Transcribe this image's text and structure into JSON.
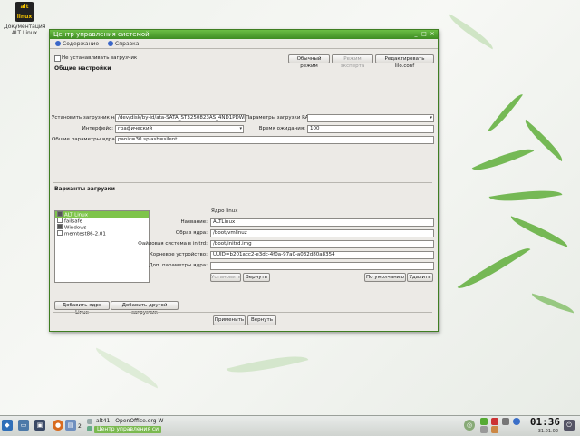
{
  "desktop": {
    "icon_label": "Документация ALT Linux",
    "logo_text": "alt linux"
  },
  "window": {
    "title": "Центр управления системой",
    "tabs": [
      {
        "label": "Содержание",
        "icon": "home-icon"
      },
      {
        "label": "Справка",
        "icon": "help-icon"
      }
    ],
    "no_install_loader_label": "Не устанавливать загрузчик",
    "top_buttons": {
      "basic_mode": "Обычный режим",
      "expert_mode": "Режим эксперта",
      "edit_conf": "Редактировать lilo.conf"
    },
    "general": {
      "heading": "Общие настройки",
      "install_to_label": "Установить загрузчик на",
      "install_to_value": "/dev/disk/by-id/ata-SATA_ST3250823AS_4ND1PDWP",
      "raid_params_label": "Параметры загрузки RAID:",
      "raid_params_value": "",
      "interface_label": "Интерфейс:",
      "interface_value": "графический",
      "timeout_label": "Время ожидания:",
      "timeout_value": "100",
      "kernel_params_label": "Общие параметры ядра:",
      "kernel_params_value": "panic=30 splash=silent"
    },
    "boot": {
      "heading": "Варианты загрузки",
      "items": [
        {
          "label": "ALT Linux",
          "checked": true,
          "selected": true
        },
        {
          "label": "failsafe",
          "checked": false,
          "selected": false
        },
        {
          "label": "Windows",
          "checked": true,
          "selected": false
        },
        {
          "label": "memtest86-2.01",
          "checked": false,
          "selected": false
        }
      ],
      "kernel_group": "Ядро linux",
      "name_label": "Название:",
      "name_value": "ALTLinux",
      "image_label": "Образ ядра:",
      "image_value": "/boot/vmlinuz",
      "initrd_label": "Файловая система в initrd:",
      "initrd_value": "/boot/initrd.img",
      "root_label": "Корневое устройство:",
      "root_value": "UUID=b201acc2-e3dc-4f0a-97a0-a032d80a8354",
      "extra_label": "Доп. параметры ядра:",
      "extra_value": "",
      "apply_btn": "Установить",
      "revert_btn": "Вернуть",
      "default_btn": "По умолчанию",
      "delete_btn": "Удалить",
      "add_linux_btn": "Добавить ядро Linux",
      "add_other_btn": "Добавить другой загрузчик"
    },
    "bottom": {
      "apply": "Применить",
      "revert": "Вернуть"
    }
  },
  "taskbar": {
    "tasks": [
      {
        "label": "alt41 - OpenOffice.org W",
        "active": false
      },
      {
        "label": "Центр управления си",
        "active": true
      }
    ],
    "desktop_num": "2",
    "clock": "01:36",
    "date": "31.01.02"
  },
  "colors": {
    "accent": "#5aaa32",
    "selection": "#7ec44a",
    "window_bg": "#eceae6"
  }
}
